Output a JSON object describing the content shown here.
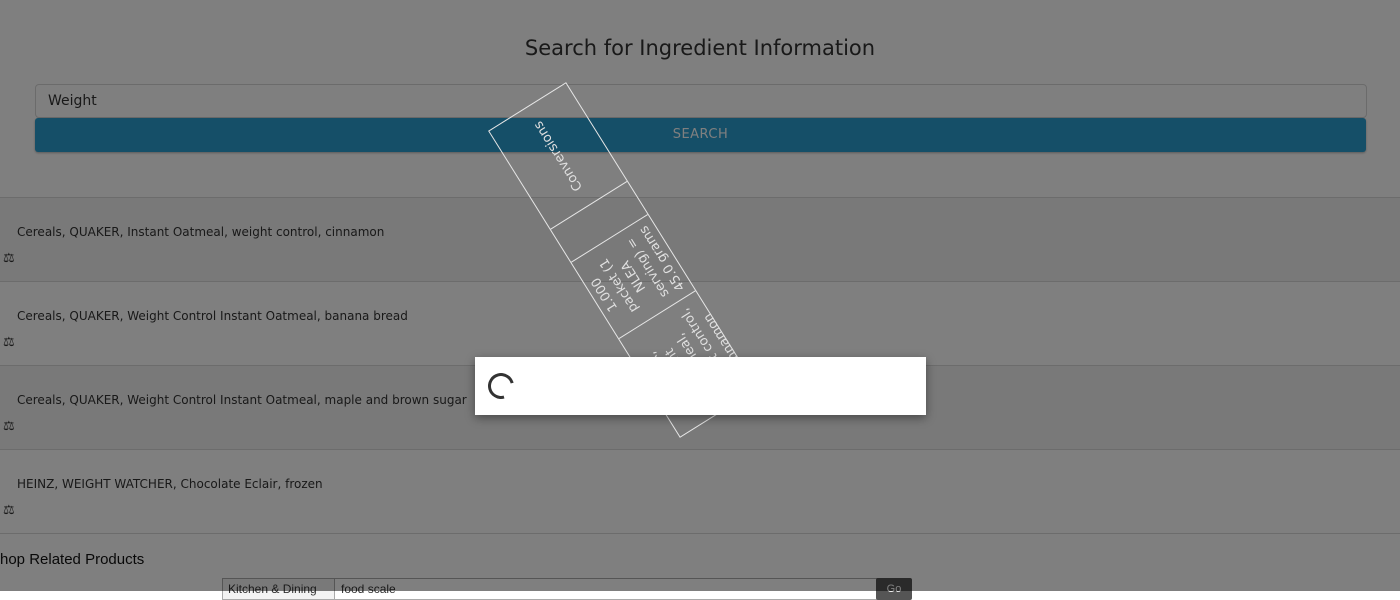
{
  "header": {
    "title": "Search for Ingredient Information"
  },
  "search": {
    "value": "Weight",
    "button_label": "SEARCH"
  },
  "results": [
    {
      "name": "Cereals, QUAKER, Instant Oatmeal, weight control, cinnamon",
      "icon": "scale-icon"
    },
    {
      "name": "Cereals, QUAKER, Weight Control Instant Oatmeal, banana bread",
      "icon": "scale-icon"
    },
    {
      "name": "Cereals, QUAKER, Weight Control Instant Oatmeal, maple and brown sugar",
      "icon": "scale-icon"
    },
    {
      "name": "HEINZ, WEIGHT WATCHER, Chocolate Eclair, frozen",
      "icon": "scale-icon"
    }
  ],
  "shop": {
    "title": "hop Related Products",
    "category": "Kitchen & Dining",
    "query": "food scale",
    "go_label": "Go"
  },
  "conversion_table": {
    "cells": [
      "Cereals, QUAKER, Instant Oatmeal, weight control, cinnamon",
      "1.000 packet (1 NLEA serving) = 45.0 grams",
      "",
      "Conversions"
    ]
  },
  "colors": {
    "accent": "#2a9fd0",
    "overlay": "rgba(0,0,0,0.5)"
  }
}
